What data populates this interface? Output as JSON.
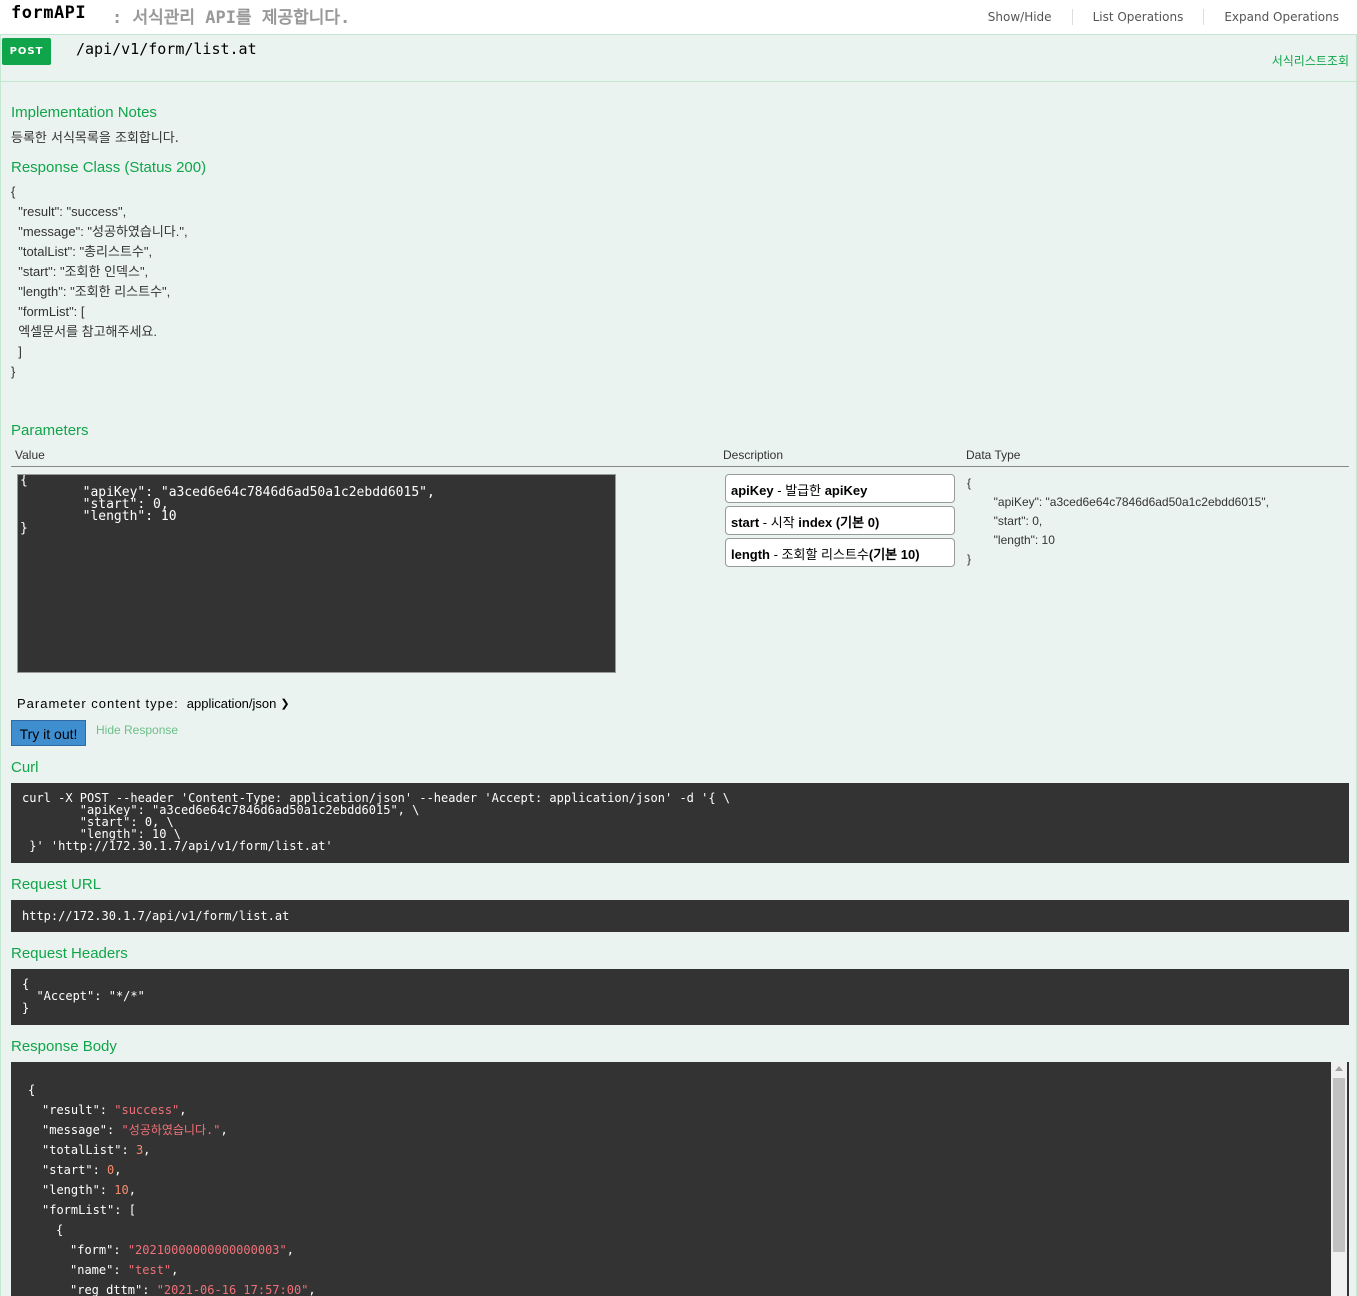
{
  "header": {
    "api_name": "formAPI",
    "api_desc": ": 서식관리 API를 제공합니다.",
    "links": [
      "Show/Hide",
      "List Operations",
      "Expand Operations"
    ]
  },
  "operation": {
    "method": "POST",
    "path": "/api/v1/form/list.at",
    "summary": "서식리스트조회",
    "method_color": "#10a54a"
  },
  "implementation_notes": {
    "title": "Implementation Notes",
    "text": "등록한 서식목록을 조회합니다."
  },
  "response_class": {
    "title": "Response Class (Status 200)",
    "json": "{\n  \"result\": \"success\",\n  \"message\": \"성공하였습니다.\",\n  \"totalList\": \"총리스트수\",\n  \"start\": \"조회한 인덱스\",\n  \"length\": \"조회한 리스트수\",\n  \"formList\": [\n  엑셀문서를 참고해주세요.\n  ]\n}"
  },
  "parameters": {
    "title": "Parameters",
    "columns": {
      "value": "Value",
      "description": "Description",
      "data_type": "Data Type"
    },
    "value": "{\n        \"apiKey\": \"a3ced6e64c7846d6ad50a1c2ebdd6015\",\n        \"start\": 0,\n        \"length\": 10\n}",
    "descriptions": [
      {
        "name": "apiKey",
        "text": " - 발급한 ",
        "bold_tail": "apiKey"
      },
      {
        "name": "start",
        "text": " - 시작 ",
        "bold_tail": "index (기본 0)"
      },
      {
        "name": "length",
        "text": " - 조회할 리스트수",
        "bold_tail": "(기본 10)"
      }
    ],
    "data_type": "{\n        \"apiKey\": \"a3ced6e64c7846d6ad50a1c2ebdd6015\",\n        \"start\": 0,\n        \"length\": 10\n}",
    "content_type_label": "Parameter content type:",
    "content_type_value": "application/json"
  },
  "actions": {
    "try_label": "Try it out!",
    "hide_label": "Hide Response"
  },
  "curl": {
    "title": "Curl",
    "text": "curl -X POST --header 'Content-Type: application/json' --header 'Accept: application/json' -d '{ \\\n        \"apiKey\": \"a3ced6e64c7846d6ad50a1c2ebdd6015\", \\\n        \"start\": 0, \\\n        \"length\": 10 \\\n }' 'http://172.30.1.7/api/v1/form/list.at'"
  },
  "request_url": {
    "title": "Request URL",
    "text": "http://172.30.1.7/api/v1/form/list.at"
  },
  "request_headers": {
    "title": "Request Headers",
    "text": "{\n  \"Accept\": \"*/*\"\n}"
  },
  "response_body": {
    "title": "Response Body",
    "lines": [
      {
        "indent": 0,
        "key": "",
        "value": "{",
        "vtype": "punct"
      },
      {
        "indent": 1,
        "key": "\"result\"",
        "value": "\"success\"",
        "vtype": "str",
        "trail": ","
      },
      {
        "indent": 1,
        "key": "\"message\"",
        "value": "\"성공하였습니다.\"",
        "vtype": "str",
        "trail": ","
      },
      {
        "indent": 1,
        "key": "\"totalList\"",
        "value": "3",
        "vtype": "num",
        "trail": ","
      },
      {
        "indent": 1,
        "key": "\"start\"",
        "value": "0",
        "vtype": "num",
        "trail": ","
      },
      {
        "indent": 1,
        "key": "\"length\"",
        "value": "10",
        "vtype": "num",
        "trail": ","
      },
      {
        "indent": 1,
        "key": "\"formList\"",
        "value": "[",
        "vtype": "punct"
      },
      {
        "indent": 2,
        "key": "",
        "value": "{",
        "vtype": "punct"
      },
      {
        "indent": 3,
        "key": "\"form\"",
        "value": "\"20210000000000000003\"",
        "vtype": "str",
        "trail": ","
      },
      {
        "indent": 3,
        "key": "\"name\"",
        "value": "\"test\"",
        "vtype": "str",
        "trail": ","
      },
      {
        "indent": 3,
        "key": "\"reg_dttm\"",
        "value": "\"2021-06-16 17:57:00\"",
        "vtype": "str",
        "trail": ","
      }
    ],
    "colors": {
      "string": "#f07178",
      "number": "#f78c6c"
    }
  }
}
